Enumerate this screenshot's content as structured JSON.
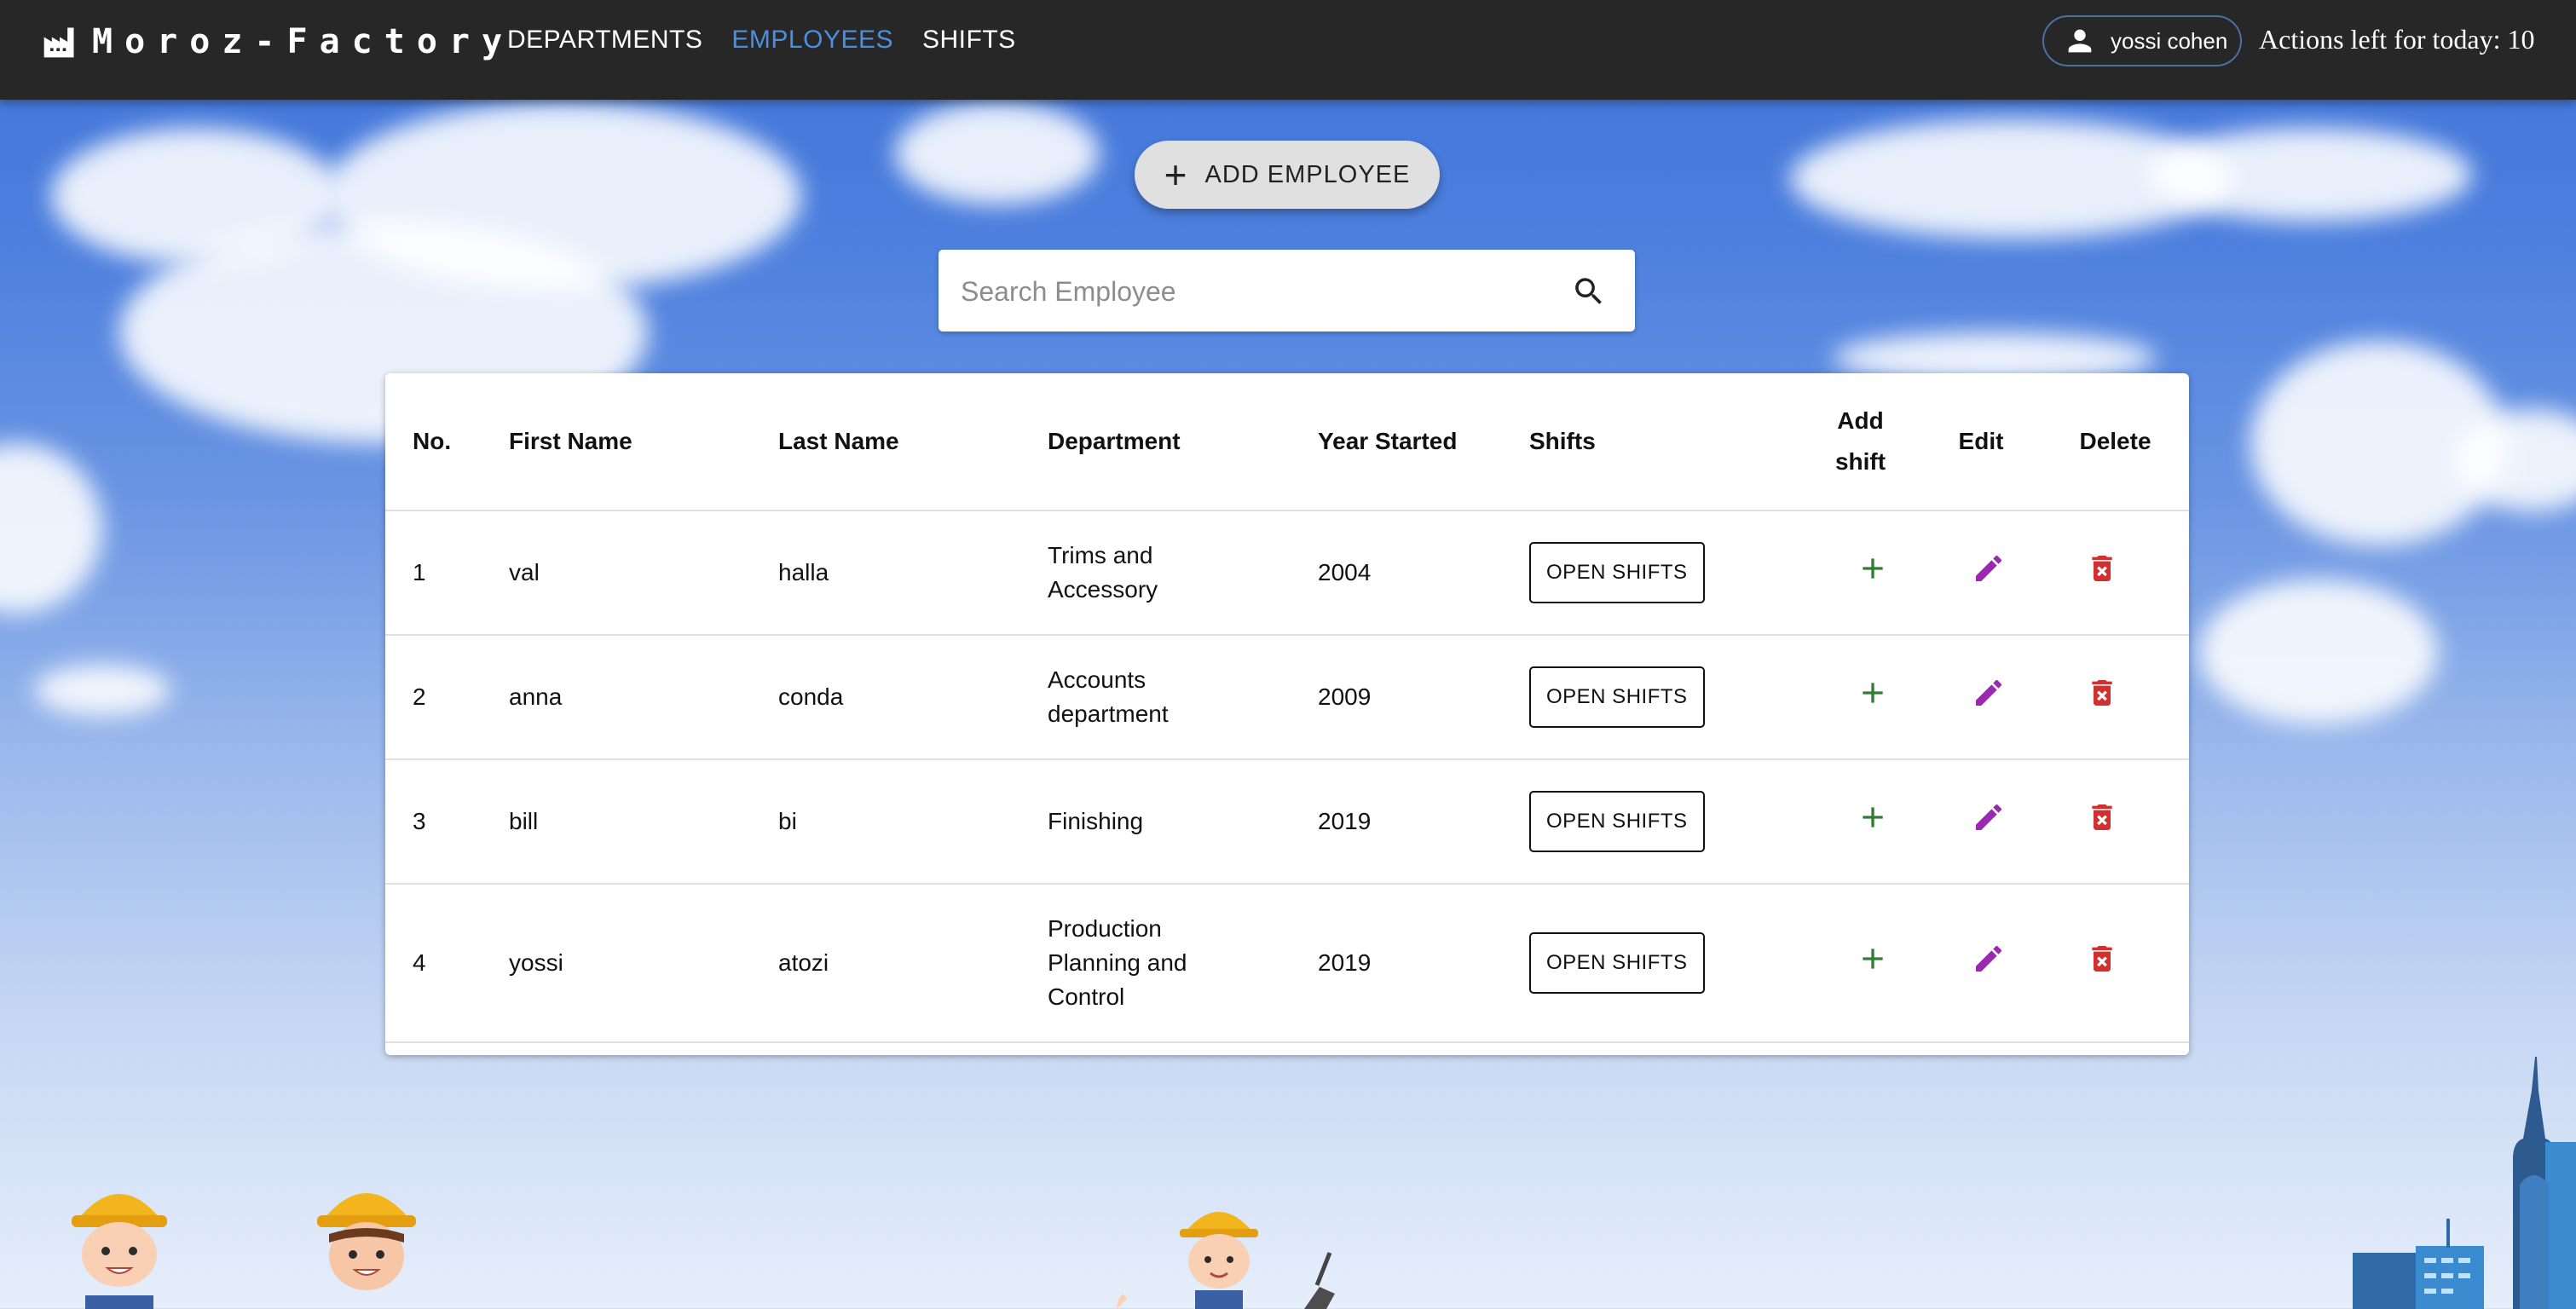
{
  "app": {
    "brand": "Moroz-Factory",
    "nav": [
      {
        "label": "DEPARTMENTS",
        "active": false
      },
      {
        "label": "EMPLOYEES",
        "active": true
      },
      {
        "label": "SHIFTS",
        "active": false
      }
    ],
    "user": "yossi cohen",
    "actions_left": "Actions left for today: 10"
  },
  "toolbar": {
    "add_employee_label": "ADD EMPLOYEE"
  },
  "search": {
    "placeholder": "Search Employee",
    "value": ""
  },
  "table": {
    "headers": {
      "no": "No.",
      "first_name": "First Name",
      "last_name": "Last Name",
      "department": "Department",
      "year_started": "Year Started",
      "shifts": "Shifts",
      "add_shift_line1": "Add",
      "add_shift_line2": "shift",
      "edit": "Edit",
      "delete": "Delete"
    },
    "rows": [
      {
        "no": "1",
        "first_name": "val",
        "last_name": "halla",
        "department": "Trims and Accessory",
        "year": "2004",
        "shifts_button": "OPEN SHIFTS"
      },
      {
        "no": "2",
        "first_name": "anna",
        "last_name": "conda",
        "department": "Accounts department",
        "year": "2009",
        "shifts_button": "OPEN SHIFTS"
      },
      {
        "no": "3",
        "first_name": "bill",
        "last_name": "bi",
        "department": "Finishing",
        "year": "2019",
        "shifts_button": "OPEN SHIFTS"
      },
      {
        "no": "4",
        "first_name": "yossi",
        "last_name": "atozi",
        "department": "Production Planning and Control",
        "year": "2019",
        "shifts_button": "OPEN SHIFTS"
      }
    ]
  },
  "colors": {
    "topbar": "#272727",
    "nav_active": "#4a8fe0",
    "add_shift_icon": "#2e7d32",
    "edit_icon": "#9c27b0",
    "delete_icon": "#d32f2f"
  },
  "icons": {
    "brand": "factory-icon",
    "user": "person-icon",
    "search": "search-icon",
    "add": "plus-icon",
    "edit": "pencil-icon",
    "delete": "trash-icon"
  }
}
